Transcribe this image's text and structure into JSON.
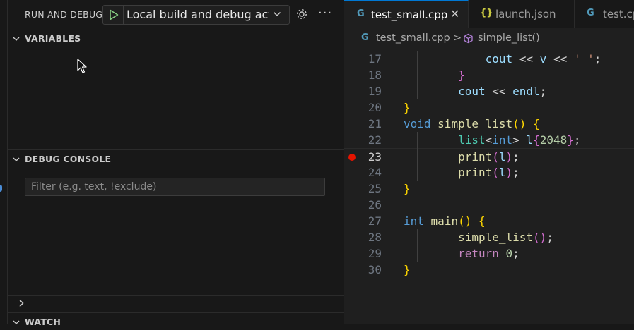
{
  "run_debug": {
    "title": "RUN AND DEBUG",
    "config_selected": "Local build and debug active",
    "icons": {
      "start": "play-icon",
      "settings": "gear-icon",
      "more": "ellipsis-icon"
    }
  },
  "sections": {
    "variables": "VARIABLES",
    "debug_console": "DEBUG CONSOLE",
    "watch": "WATCH"
  },
  "console_filter": {
    "placeholder": "Filter (e.g. text, !exclude)",
    "value": ""
  },
  "tabs": [
    {
      "icon": "G",
      "label": "test_small.cpp",
      "active": true
    },
    {
      "icon": "{}",
      "label": "launch.json",
      "active": false
    },
    {
      "icon": "G",
      "label": "test.cpp",
      "active": false
    }
  ],
  "breadcrumb": {
    "file": "test_small.cpp",
    "sep": ">",
    "symbol": "simple_list()"
  },
  "editor": {
    "current_line": 23,
    "breakpoint_line": 23,
    "line_numbers": [
      "17",
      "18",
      "19",
      "20",
      "21",
      "22",
      "23",
      "24",
      "25",
      "26",
      "27",
      "28",
      "29",
      "30"
    ],
    "code": [
      "            cout << v << ' ';",
      "        }",
      "        cout << endl;",
      "}",
      "void simple_list() {",
      "        list<int> l{2048};",
      "        print(l);",
      "        print(l);",
      "}",
      "",
      "int main() {",
      "        simple_list();",
      "        return 0;",
      "}"
    ]
  },
  "colors": {
    "accent": "#0078d4",
    "breakpoint": "#e51400",
    "play": "#89d185",
    "cpp_icon": "#519aba",
    "json_icon": "#cbcb41"
  }
}
